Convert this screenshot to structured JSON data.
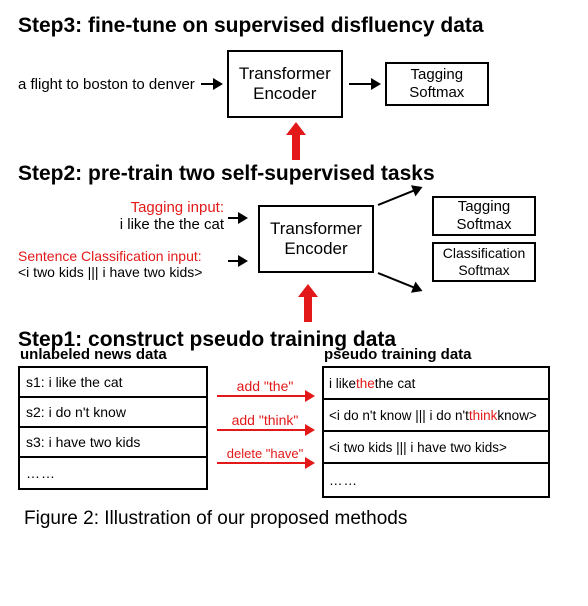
{
  "step3": {
    "title": "Step3: fine-tune on supervised disfluency data",
    "input": "a flight to boston to denver",
    "encoder": "Transformer Encoder",
    "output": "Tagging Softmax"
  },
  "step2": {
    "title": "Step2: pre-train two self-supervised tasks",
    "tagging_label": "Tagging input:",
    "tagging_value": "i like the the cat",
    "class_label": "Sentence Classification input:",
    "class_value": "<i two kids ||| i have two kids>",
    "encoder": "Transformer Encoder",
    "out1": "Tagging Softmax",
    "out2": "Classification Softmax"
  },
  "step1": {
    "title": "Step1: construct pseudo training data",
    "left_header": "unlabeled news data",
    "right_header": "pseudo training data",
    "left_rows": [
      "s1: i like the cat",
      "s2: i do n't know",
      "s3: i have two kids",
      "……"
    ],
    "mid_labels": [
      "add \"the\"",
      "add \"think\"",
      "delete \"have\""
    ],
    "right_rows": [
      {
        "pre": "i like ",
        "red": "the",
        "post": " the cat"
      },
      {
        "pre": "<i do n't know ||| i do n't ",
        "red": "think",
        "post": " know>"
      },
      {
        "pre": "<i two kids ||| i have two kids>",
        "red": "",
        "post": ""
      },
      {
        "pre": "……",
        "red": "",
        "post": ""
      }
    ]
  },
  "caption": "Figure 2: Illustration of our proposed methods"
}
